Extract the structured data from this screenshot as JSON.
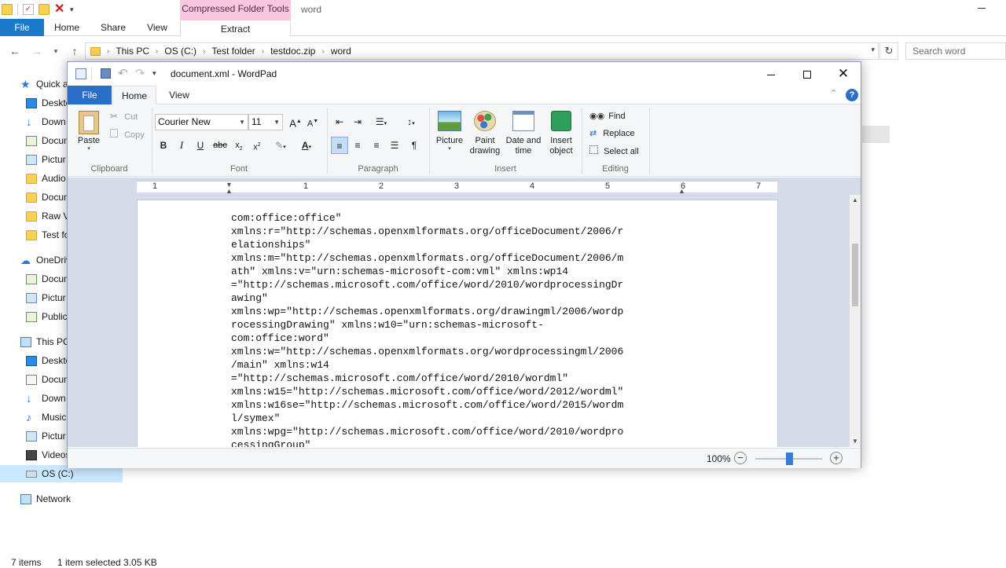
{
  "explorer": {
    "contextual_tab_header": "Compressed Folder Tools",
    "window_title": "word",
    "tabs": [
      {
        "label": "File"
      },
      {
        "label": "Home"
      },
      {
        "label": "Share"
      },
      {
        "label": "View"
      },
      {
        "label": "Extract"
      }
    ],
    "breadcrumb": [
      "This PC",
      "OS (C:)",
      "Test folder",
      "testdoc.zip",
      "word"
    ],
    "search_placeholder": "Search word",
    "nav_items": [
      {
        "label": "Quick a",
        "icon": "star-icon"
      },
      {
        "label": "Deskto",
        "icon": "desktop-icon"
      },
      {
        "label": "Down",
        "icon": "download-icon"
      },
      {
        "label": "Docum",
        "icon": "documents-icon"
      },
      {
        "label": "Pictur",
        "icon": "pictures-icon"
      },
      {
        "label": "Audio",
        "icon": "folder-icon"
      },
      {
        "label": "Docum",
        "icon": "folder-icon"
      },
      {
        "label": "Raw V",
        "icon": "folder-icon"
      },
      {
        "label": "Test fo",
        "icon": "folder-icon"
      },
      {
        "label": "OneDriv",
        "icon": "cloud-icon"
      },
      {
        "label": "Docum",
        "icon": "documents-icon"
      },
      {
        "label": "Pictur",
        "icon": "pictures-icon"
      },
      {
        "label": "Public",
        "icon": "documents-icon"
      },
      {
        "label": "This PC",
        "icon": "pc-icon"
      },
      {
        "label": "Deskto",
        "icon": "desktop-icon"
      },
      {
        "label": "Docum",
        "icon": "documents-icon"
      },
      {
        "label": "Down",
        "icon": "download-icon"
      },
      {
        "label": "Music",
        "icon": "music-icon"
      },
      {
        "label": "Pictur",
        "icon": "pictures-icon"
      },
      {
        "label": "Videos",
        "icon": "video-icon"
      },
      {
        "label": "OS (C:)",
        "icon": "drive-icon"
      },
      {
        "label": "Network",
        "icon": "network-icon"
      }
    ],
    "status": {
      "items": "7 items",
      "selection": "1 item selected  3.05 KB"
    }
  },
  "wordpad": {
    "title": "document.xml - WordPad",
    "tabs": {
      "file": "File",
      "home": "Home",
      "view": "View"
    },
    "clipboard": {
      "paste": "Paste",
      "cut": "Cut",
      "copy": "Copy",
      "group": "Clipboard"
    },
    "font": {
      "family": "Courier New",
      "size": "11",
      "group": "Font"
    },
    "paragraph": {
      "group": "Paragraph"
    },
    "insert": {
      "picture": "Picture",
      "paint": "Paint drawing",
      "datetime": "Date and time",
      "object": "Insert object",
      "group": "Insert"
    },
    "editing": {
      "find": "Find",
      "replace": "Replace",
      "select_all": "Select all",
      "group": "Editing"
    },
    "ruler_numbers": [
      "1",
      "1",
      "2",
      "3",
      "4",
      "5",
      "6",
      "7"
    ],
    "document_lines": [
      "com:office:office\"",
      "xmlns:r=\"http://schemas.openxmlformats.org/officeDocument/2006/r",
      "elationships\"",
      "xmlns:m=\"http://schemas.openxmlformats.org/officeDocument/2006/m",
      "ath\" xmlns:v=\"urn:schemas-microsoft-com:vml\" xmlns:wp14",
      "=\"http://schemas.microsoft.com/office/word/2010/wordprocessingDr",
      "awing\"",
      "xmlns:wp=\"http://schemas.openxmlformats.org/drawingml/2006/wordp",
      "rocessingDrawing\" xmlns:w10=\"urn:schemas-microsoft-",
      "com:office:word\"",
      "xmlns:w=\"http://schemas.openxmlformats.org/wordprocessingml/2006",
      "/main\" xmlns:w14",
      "=\"http://schemas.microsoft.com/office/word/2010/wordml\"",
      "xmlns:w15=\"http://schemas.microsoft.com/office/word/2012/wordml\"",
      "xmlns:w16se=\"http://schemas.microsoft.com/office/word/2015/wordm",
      "l/symex\"",
      "xmlns:wpg=\"http://schemas.microsoft.com/office/word/2010/wordpro",
      "cessingGroup\""
    ],
    "zoom": "100%",
    "zoom_level_fraction": 0.5
  },
  "colors": {
    "file_tab": "#1979ca",
    "wordpad_file_tab": "#2a6ec9",
    "contextual_tab": "#f6c7df",
    "selection": "#cce8ff"
  }
}
